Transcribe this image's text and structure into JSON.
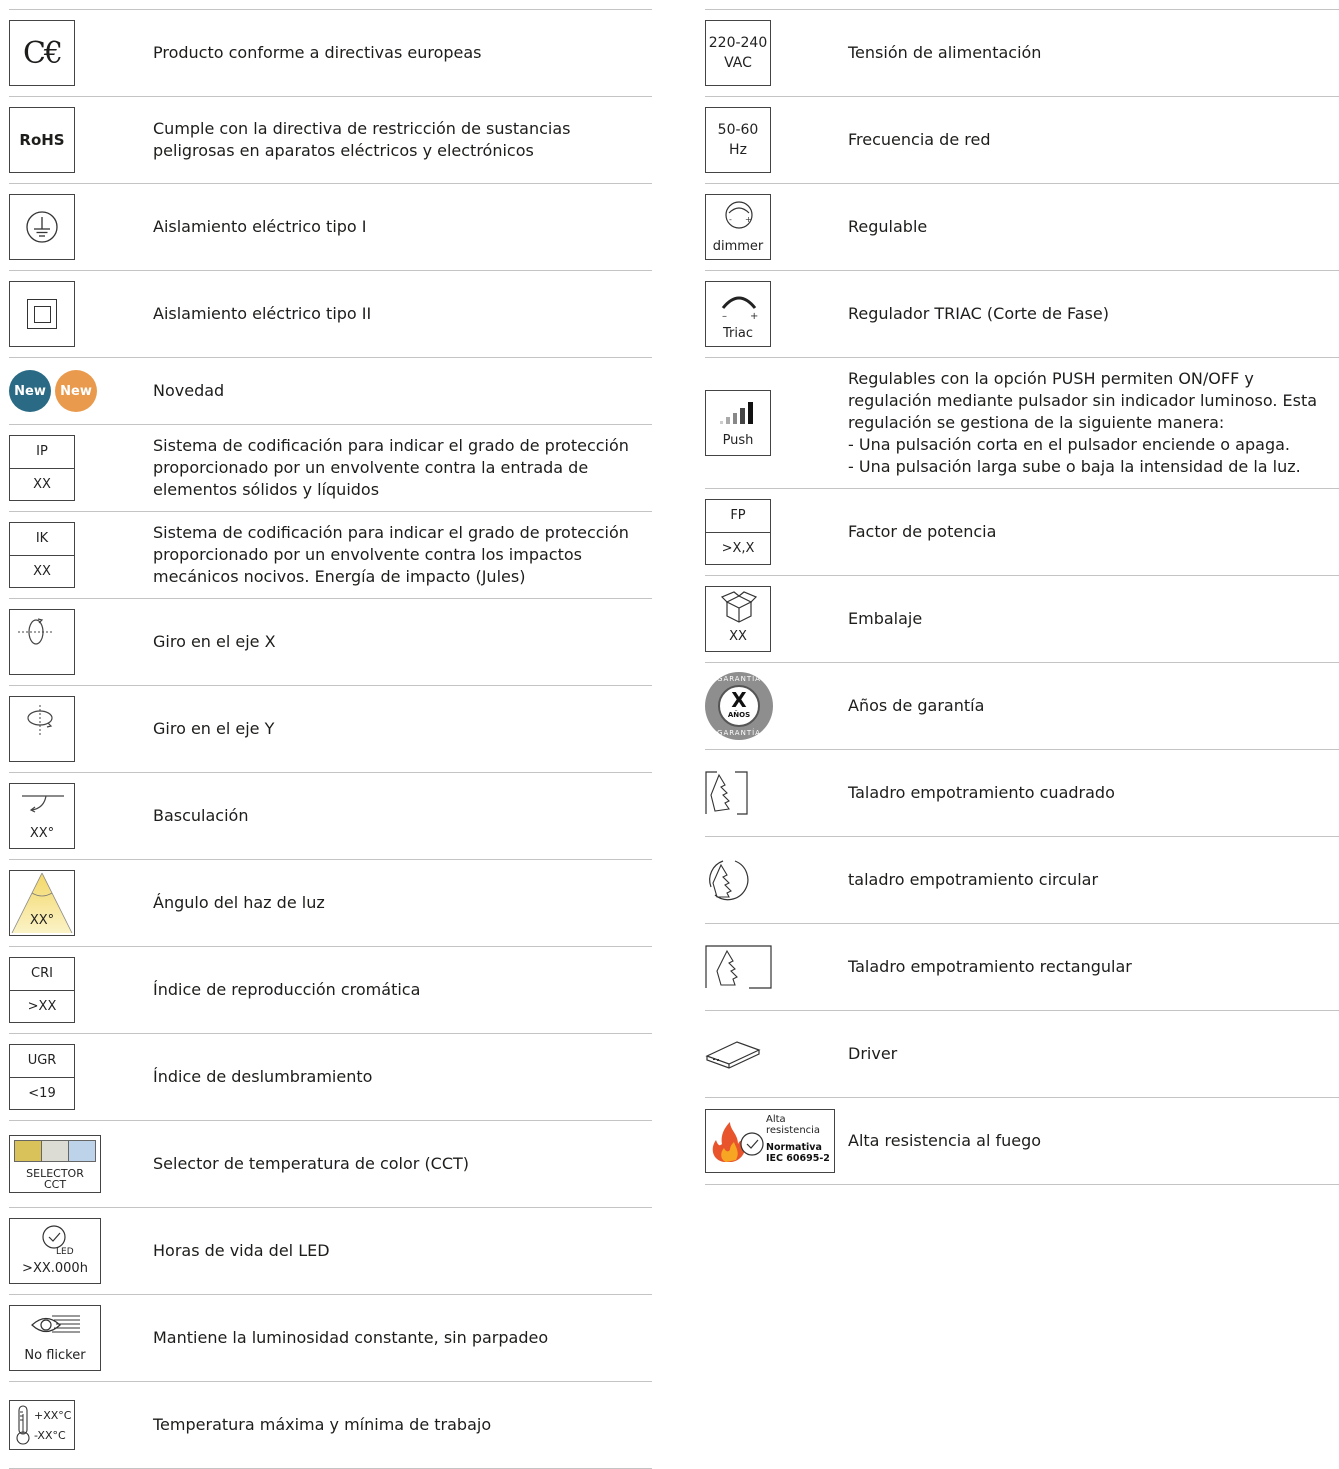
{
  "left": [
    {
      "text": "Producto conforme a directivas europeas",
      "icon": "ce-mark-icon",
      "icon_text": "C€"
    },
    {
      "text": "Cumple con la directiva de restricción de sustancias\npeligrosas en aparatos eléctricos y electrónicos",
      "icon": "rohs-icon",
      "icon_text": "RoHS"
    },
    {
      "text": "Aislamiento eléctrico tipo I",
      "icon": "earth-ground-icon"
    },
    {
      "text": "Aislamiento eléctrico tipo II",
      "icon": "double-square-icon"
    },
    {
      "text": "Novedad",
      "icon": "new-badges-icon",
      "badge_1": "New",
      "badge_2": "New",
      "badge_1_color": "#2a6a85",
      "badge_2_color": "#e99a4d"
    },
    {
      "text": "Sistema de codificación para indicar el grado de protección\nproporcionado por un envolvente contra la entrada de\nelementos sólidos y líquidos",
      "icon": "ip-rating-icon",
      "top": "IP",
      "bottom": "XX"
    },
    {
      "text": "Sistema de codificación para indicar el grado de protección\nproporcionado por un envolvente contra los impactos\nmecánicos nocivos. Energía de impacto (Jules)",
      "icon": "ik-rating-icon",
      "top": "IK",
      "bottom": "XX"
    },
    {
      "text": "Giro en el eje X",
      "icon": "rotate-x-axis-icon"
    },
    {
      "text": "Giro en el eje Y",
      "icon": "rotate-y-axis-icon"
    },
    {
      "text": "Basculación",
      "icon": "tilt-icon",
      "label": "XX°"
    },
    {
      "text": "Ángulo del haz de luz",
      "icon": "beam-angle-icon",
      "label": "XX°"
    },
    {
      "text": "Índice de reproducción cromática",
      "icon": "cri-icon",
      "top": "CRI",
      "bottom": ">XX"
    },
    {
      "text": "Índice de deslumbramiento",
      "icon": "ugr-icon",
      "top": "UGR",
      "bottom": "<19"
    },
    {
      "text": "Selector de temperatura de color (CCT)",
      "icon": "cct-selector-icon",
      "label": "SELECTOR\nCCT",
      "swatches": [
        "#d9c25a",
        "#dcdcd4",
        "#bcd3ea"
      ]
    },
    {
      "text": "Horas de vida del LED",
      "icon": "led-lifetime-clock-icon",
      "mini": "LED",
      "label": ">XX.000h"
    },
    {
      "text": "Mantiene la luminosidad constante, sin parpadeo",
      "icon": "no-flicker-eye-icon",
      "label": "No flicker"
    },
    {
      "text": "Temperatura máxima y mínima de trabajo",
      "icon": "thermometer-icon",
      "max": "+XX°C",
      "min": "-XX°C"
    }
  ],
  "right": [
    {
      "text": "Tensión de alimentación",
      "icon": "voltage-icon",
      "label": "220-240\nVAC"
    },
    {
      "text": "Frecuencia de red",
      "icon": "frequency-icon",
      "label": "50-60\nHz"
    },
    {
      "text": "Regulable",
      "icon": "dimmer-knob-icon",
      "label": "dimmer"
    },
    {
      "text": "Regulador TRIAC (Corte de Fase)",
      "icon": "triac-icon",
      "label": "Triac"
    },
    {
      "text": "Regulables con la opción PUSH permiten ON/OFF y\nregulación mediante pulsador sin indicador luminoso. Esta\nregulación se gestiona de la siguiente manera:\n- Una pulsación corta en el pulsador enciende o apaga.\n- Una pulsación larga sube o baja la intensidad de la luz.",
      "icon": "push-signal-bars-icon",
      "label": "Push"
    },
    {
      "text": "Factor de potencia",
      "icon": "power-factor-icon",
      "top": "FP",
      "bottom": ">X,X"
    },
    {
      "text": "Embalaje",
      "icon": "package-box-icon",
      "label": "XX"
    },
    {
      "text": "Años de garantía",
      "icon": "warranty-seal-icon",
      "ring": "GARANTÍA",
      "number": "X",
      "unit": "AÑOS"
    },
    {
      "text": "Taladro empotramiento cuadrado",
      "icon": "square-cutout-saw-icon"
    },
    {
      "text": "taladro empotramiento circular",
      "icon": "circular-cutout-saw-icon"
    },
    {
      "text": "Taladro empotramiento rectangular",
      "icon": "rectangular-cutout-saw-icon"
    },
    {
      "text": "Driver",
      "icon": "driver-box-icon"
    },
    {
      "text": "Alta resistencia al fuego",
      "icon": "fire-resistance-icon",
      "small": "Alta\nresistencia",
      "norm": "Normativa\nIEC 60695-2"
    }
  ]
}
